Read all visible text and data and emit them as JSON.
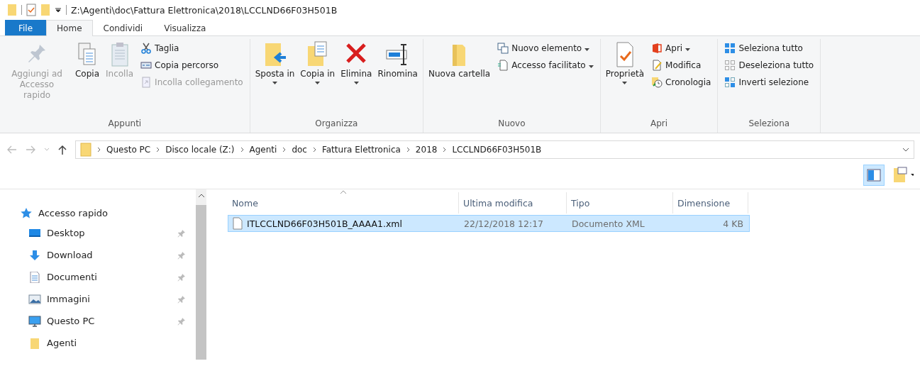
{
  "window": {
    "title": "Z:\\Agenti\\doc\\Fattura Elettronica\\2018\\LCCLND66F03H501B"
  },
  "tabs": [
    {
      "label": "File",
      "kind": "file",
      "selected": false
    },
    {
      "label": "Home",
      "kind": "tab",
      "selected": true
    },
    {
      "label": "Condividi",
      "kind": "tab",
      "selected": false
    },
    {
      "label": "Visualizza",
      "kind": "tab",
      "selected": false
    }
  ],
  "ribbon": {
    "groups": [
      {
        "label": "Appunti",
        "items": [
          {
            "kind": "large",
            "label": "Aggiungi ad Accesso rapido",
            "disabled": true,
            "dropdown": false
          },
          {
            "kind": "large",
            "label": "Copia",
            "disabled": false,
            "dropdown": false
          },
          {
            "kind": "large",
            "label": "Incolla",
            "disabled": true,
            "dropdown": false
          },
          {
            "kind": "stack",
            "items": [
              {
                "label": "Taglia",
                "disabled": false,
                "dropdown": false
              },
              {
                "label": "Copia percorso",
                "disabled": false,
                "dropdown": false
              },
              {
                "label": "Incolla collegamento",
                "disabled": true,
                "dropdown": false
              }
            ]
          }
        ]
      },
      {
        "label": "Organizza",
        "items": [
          {
            "kind": "large",
            "label": "Sposta in",
            "disabled": false,
            "dropdown": true
          },
          {
            "kind": "large",
            "label": "Copia in",
            "disabled": false,
            "dropdown": true
          },
          {
            "kind": "large",
            "label": "Elimina",
            "disabled": false,
            "dropdown": true
          },
          {
            "kind": "large",
            "label": "Rinomina",
            "disabled": false,
            "dropdown": false
          }
        ]
      },
      {
        "label": "Nuovo",
        "items": [
          {
            "kind": "large",
            "label": "Nuova cartella",
            "disabled": false,
            "dropdown": false
          },
          {
            "kind": "stack",
            "items": [
              {
                "label": "Nuovo elemento",
                "disabled": false,
                "dropdown": true
              },
              {
                "label": "Accesso facilitato",
                "disabled": false,
                "dropdown": true
              }
            ]
          }
        ]
      },
      {
        "label": "Apri",
        "items": [
          {
            "kind": "large",
            "label": "Proprietà",
            "disabled": false,
            "dropdown": true
          },
          {
            "kind": "stack",
            "items": [
              {
                "label": "Apri",
                "disabled": false,
                "dropdown": true
              },
              {
                "label": "Modifica",
                "disabled": false,
                "dropdown": false
              },
              {
                "label": "Cronologia",
                "disabled": false,
                "dropdown": false
              }
            ]
          }
        ]
      },
      {
        "label": "Seleziona",
        "items": [
          {
            "kind": "stack",
            "items": [
              {
                "label": "Seleziona tutto",
                "disabled": false,
                "dropdown": false
              },
              {
                "label": "Deseleziona tutto",
                "disabled": false,
                "dropdown": false
              },
              {
                "label": "Inverti selezione",
                "disabled": false,
                "dropdown": false
              }
            ]
          }
        ]
      }
    ]
  },
  "address_bar": {
    "crumbs": [
      "Questo PC",
      "Disco locale (Z:)",
      "Agenti",
      "doc",
      "Fattura Elettronica",
      "2018",
      "LCCLND66F03H501B"
    ]
  },
  "sidebar": {
    "items": [
      {
        "label": "Accesso rapido",
        "kind": "header",
        "pinned": false
      },
      {
        "label": "Desktop",
        "kind": "item",
        "pinned": true
      },
      {
        "label": "Download",
        "kind": "item",
        "pinned": true
      },
      {
        "label": "Documenti",
        "kind": "item",
        "pinned": true
      },
      {
        "label": "Immagini",
        "kind": "item",
        "pinned": true
      },
      {
        "label": "Questo PC",
        "kind": "item",
        "pinned": true
      },
      {
        "label": "Agenti",
        "kind": "item",
        "pinned": false
      }
    ]
  },
  "table": {
    "columns": [
      {
        "label": "Nome",
        "sorted": true
      },
      {
        "label": "Ultima modifica",
        "sorted": false
      },
      {
        "label": "Tipo",
        "sorted": false
      },
      {
        "label": "Dimensione",
        "sorted": false
      }
    ],
    "rows": [
      {
        "selected": true,
        "cells": [
          "ITLCCLND66F03H501B_AAAA1.xml",
          "22/12/2018 12:17",
          "Documento XML",
          "4 KB"
        ]
      }
    ]
  }
}
